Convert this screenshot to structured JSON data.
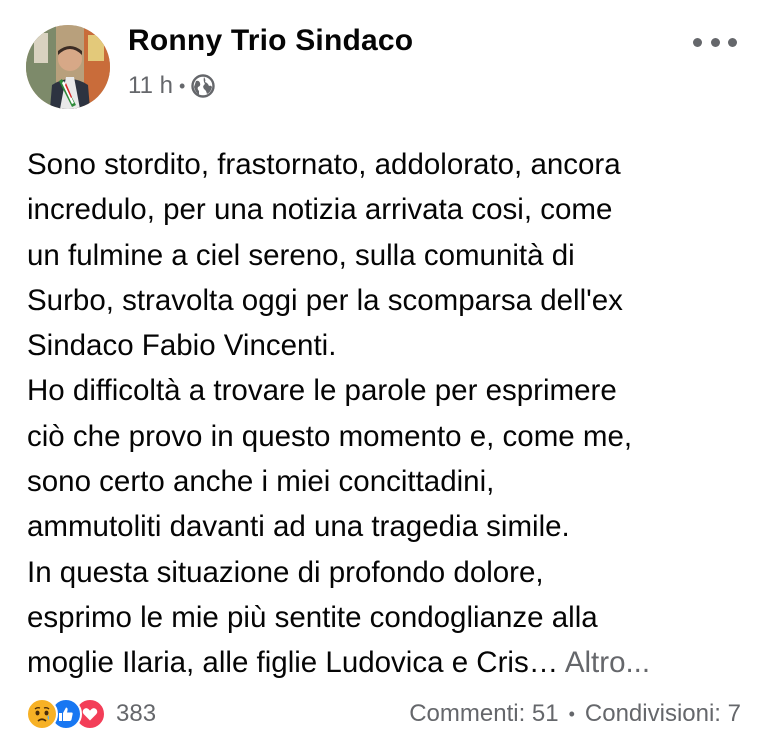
{
  "post": {
    "author": "Ronny Trio Sindaco",
    "time": "11 h",
    "separator": "•",
    "privacy_icon": "globe-icon",
    "more_icon": "more-horizontal-icon",
    "body_lines": [
      "Sono stordito, frastornato,  addolorato, ancora",
      "incredulo, per una notizia arrivata cosi, come",
      "un fulmine a ciel sereno, sulla comunità di",
      "Surbo, stravolta oggi per la scomparsa dell'ex",
      "Sindaco Fabio Vincenti.",
      "Ho difficoltà a trovare le parole per esprimere",
      "ciò che provo in questo momento e, come me,",
      "sono certo anche i miei concittadini,",
      "ammutoliti davanti ad una tragedia simile.",
      "In questa situazione di profondo dolore,",
      "esprimo le mie più sentite condoglianze alla",
      "moglie Ilaria, alle figlie Ludovica e Cris…"
    ],
    "see_more": "Altro..."
  },
  "footer": {
    "reaction_icons": [
      "sad-reaction-icon",
      "like-reaction-icon",
      "love-reaction-icon"
    ],
    "reactions_count": "383",
    "comments": "Commenti: 51",
    "separator": "•",
    "shares": "Condivisioni: 7"
  },
  "colors": {
    "text": "#050505",
    "secondary": "#65676b",
    "like_blue": "#1877f2",
    "love_red": "#f33e58",
    "sad_yellow": "#f7b125"
  }
}
